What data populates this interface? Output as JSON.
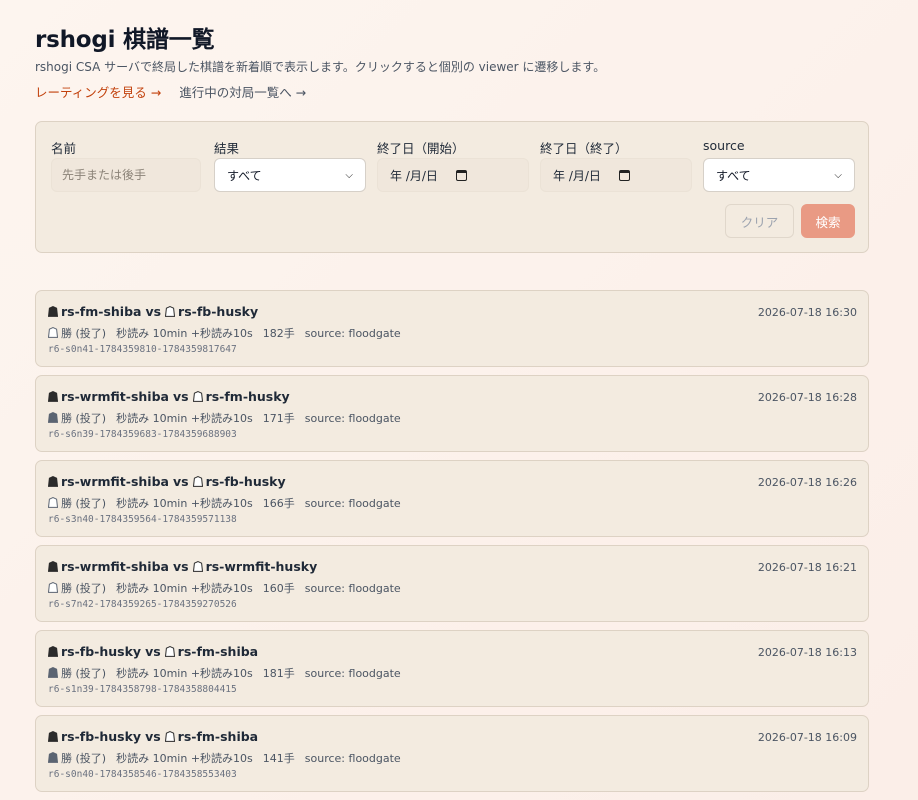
{
  "header": {
    "title": "rshogi 棋譜一覧",
    "subtitle": "rshogi CSA サーバで終局した棋譜を新着順で表示します。クリックすると個別の viewer に遷移します。",
    "rating_link": "レーティングを見る →",
    "live_link": "進行中の対局一覧へ →"
  },
  "filters": {
    "name_label": "名前",
    "name_placeholder": "先手または後手",
    "result_label": "結果",
    "result_value": "すべて",
    "start_label": "終了日（開始）",
    "start_value": "年 /月/日",
    "end_label": "終了日（終了）",
    "end_value": "年 /月/日",
    "source_label": "source",
    "source_value": "すべて",
    "clear_label": "クリア",
    "search_label": "検索"
  },
  "colors": {
    "accent": "#c2410c",
    "search_button": "#e99a84",
    "card_bg": "#f3ebe0"
  },
  "games": [
    {
      "black": "rs-fm-shiba",
      "white": "rs-fb-husky",
      "date": "2026-07-18 16:30",
      "winner": "white",
      "result": "勝 (投了)",
      "time": "秒読み 10min +秒読み10s",
      "moves": "182手",
      "source": "source: floodgate",
      "id": "r6-s0n41-1784359810-1784359817647"
    },
    {
      "black": "rs-wrmfit-shiba",
      "white": "rs-fm-husky",
      "date": "2026-07-18 16:28",
      "winner": "black",
      "result": "勝 (投了)",
      "time": "秒読み 10min +秒読み10s",
      "moves": "171手",
      "source": "source: floodgate",
      "id": "r6-s6n39-1784359683-1784359688903"
    },
    {
      "black": "rs-wrmfit-shiba",
      "white": "rs-fb-husky",
      "date": "2026-07-18 16:26",
      "winner": "white",
      "result": "勝 (投了)",
      "time": "秒読み 10min +秒読み10s",
      "moves": "166手",
      "source": "source: floodgate",
      "id": "r6-s3n40-1784359564-1784359571138"
    },
    {
      "black": "rs-wrmfit-shiba",
      "white": "rs-wrmfit-husky",
      "date": "2026-07-18 16:21",
      "winner": "white",
      "result": "勝 (投了)",
      "time": "秒読み 10min +秒読み10s",
      "moves": "160手",
      "source": "source: floodgate",
      "id": "r6-s7n42-1784359265-1784359270526"
    },
    {
      "black": "rs-fb-husky",
      "white": "rs-fm-shiba",
      "date": "2026-07-18 16:13",
      "winner": "black",
      "result": "勝 (投了)",
      "time": "秒読み 10min +秒読み10s",
      "moves": "181手",
      "source": "source: floodgate",
      "id": "r6-s1n39-1784358798-1784358804415"
    },
    {
      "black": "rs-fb-husky",
      "white": "rs-fm-shiba",
      "date": "2026-07-18 16:09",
      "winner": "black",
      "result": "勝 (投了)",
      "time": "秒読み 10min +秒読み10s",
      "moves": "141手",
      "source": "source: floodgate",
      "id": "r6-s0n40-1784358546-1784358553403"
    }
  ]
}
